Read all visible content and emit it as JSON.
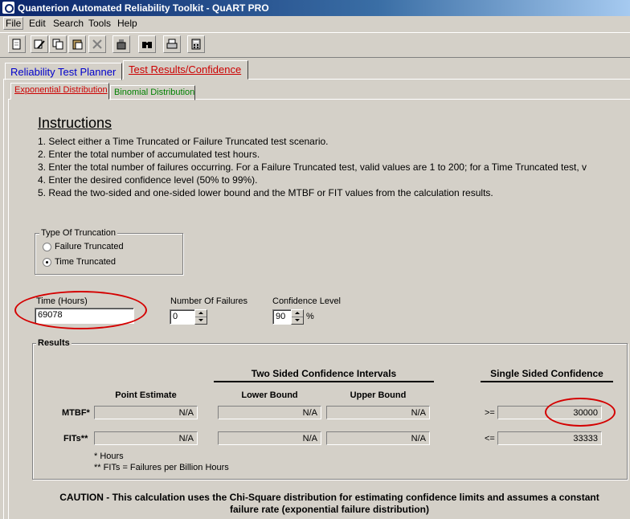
{
  "window": {
    "title": "Quanterion Automated Reliability Toolkit - QuART PRO"
  },
  "menu": [
    "File",
    "Edit",
    "Search",
    "Tools",
    "Help"
  ],
  "toolbar": {
    "icons": [
      "new-file-icon",
      "edit-record-icon",
      "copy-record-icon",
      "paste-record-icon",
      "delete-icon",
      "save-icon",
      "find-icon",
      "print-icon",
      "calculator-icon"
    ]
  },
  "tabs": {
    "main": [
      "Reliability Test Planner",
      "Test Results/Confidence"
    ],
    "sub": [
      "Exponential Distribution",
      "Binomial Distribution"
    ]
  },
  "instructions": {
    "title": "Instructions",
    "steps": [
      "1. Select either a Time Truncated or Failure Truncated test scenario.",
      "2. Enter the total number of accumulated test hours.",
      "3. Enter the total number of failures occurring. For a Failure Truncated test, valid values are 1 to 200; for a Time Truncated test, v",
      "4. Enter the desired confidence level (50% to 99%).",
      "5. Read the two-sided and one-sided lower bound and the MTBF or FIT values from the calculation results."
    ]
  },
  "truncation": {
    "legend": "Type Of Truncation",
    "options": [
      "Failure Truncated",
      "Time Truncated"
    ],
    "selected": "Time Truncated"
  },
  "inputs": {
    "time_label": "Time (Hours)",
    "time_value": "69078",
    "failures_label": "Number Of Failures",
    "failures_value": "0",
    "confidence_label": "Confidence Level",
    "confidence_value": "90",
    "confidence_unit": "%"
  },
  "results": {
    "legend": "Results",
    "two_sided_header": "Two Sided Confidence Intervals",
    "single_sided_header": "Single Sided Confidence",
    "col_point": "Point Estimate",
    "col_lower": "Lower Bound",
    "col_upper": "Upper Bound",
    "mtbf": {
      "label": "MTBF*",
      "point": "N/A",
      "lower": "N/A",
      "upper": "N/A",
      "op": ">=",
      "single": "30000"
    },
    "fits": {
      "label": "FITs**",
      "point": "N/A",
      "lower": "N/A",
      "upper": "N/A",
      "op": "<=",
      "single": "33333"
    },
    "note1": "* Hours",
    "note2": "** FITs = Failures per Billion Hours"
  },
  "caution": {
    "line1": "CAUTION - This calculation uses the Chi-Square distribution for estimating confidence limits and assumes a constant",
    "line2": "failure rate (exponential failure distribution)"
  },
  "colors": {
    "highlight": "#d40000",
    "tab_active": "#cc0000",
    "tab_main": "#0000cc",
    "tab_sub_inactive": "#008000"
  }
}
